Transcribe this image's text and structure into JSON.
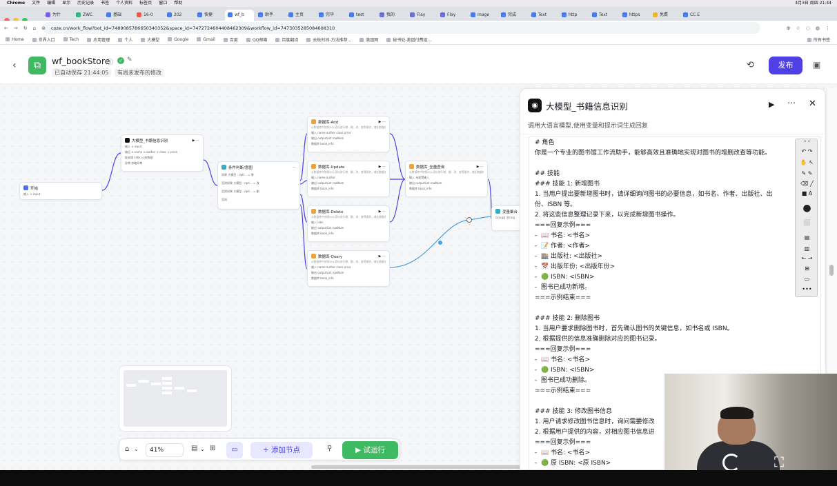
{
  "menubar": {
    "app": "Chrome",
    "items": [
      "文件",
      "编辑",
      "显示",
      "历史记录",
      "书签",
      "个人资料",
      "标签页",
      "窗口",
      "帮助"
    ],
    "clock": "4月3日 周四 21:44"
  },
  "tabs": [
    "为什",
    "ZWC",
    "基础",
    "16-0",
    "202",
    "快捷",
    "wf_b",
    "助手",
    "主页",
    "完毕",
    "test",
    "我的",
    "Flay",
    "Flay",
    "mage",
    "完成",
    "Text",
    "http",
    "Text",
    "https",
    "免费",
    "CC E"
  ],
  "address": {
    "url": "coze.cn/work_flow?bot_id=7489085786650340352&space_id=7472724604408462309&workflow_id=7473035285084608310"
  },
  "bookmarks": [
    "Home",
    "世界入口",
    "Tech",
    "应用管理",
    "个人",
    "大模型",
    "Google",
    "Gmail",
    "百度",
    "QQ邮箱",
    "百度翻译",
    "云秋时间-方法推荐...",
    "美团网",
    "秘书处-美团付费组..."
  ],
  "bookmarks_right": "所有书签",
  "header": {
    "back": "‹",
    "title": "wf_bookStore",
    "autosave": "已自动保存 21:44:05",
    "unpublished": "有尚未发布的修改",
    "publish": "发布"
  },
  "nodes": {
    "start": {
      "title": "开始",
      "row": "输入  ⊙ input"
    },
    "llm": {
      "title": "大模型_书籍信息识别",
      "rows": [
        "输入  ⊙ input",
        "输出  ⊙ name  ⊙ author  ⊙ class  ⊙ price",
        "批处理  分析(入)的数据",
        "异常  忽略异常"
      ]
    },
    "cond": {
      "title": "条件判断/意图",
      "rows": [
        "如果  大模型 - opti... = 增",
        "否则如果  大模型 - opti... = 改",
        "否则如果  大模型 - opti... = 删",
        "否则"
      ]
    },
    "add": {
      "title": "数据库-Add",
      "desc": "从数据库中按照SQL语句进行增、删、改、查等操作，输出数据库数据结果",
      "rows": [
        "输入  name  author  class  price",
        "输出  outputList  rowNum",
        "数据库  book_info"
      ]
    },
    "update": {
      "title": "数据库-Update",
      "desc": "从数据库中按照SQL语句进行增、删、改、查等操作，输出数据库数据结果",
      "rows": [
        "输入  name  author",
        "输出  outputList  rowNum",
        "数据库  book_info"
      ]
    },
    "delete": {
      "title": "数据库-Delete",
      "desc": "从数据库中按照SQL语句进行增、删、改、查等操作，输出数据库数据结果",
      "rows": [
        "输入  isbn",
        "输出  outputList  rowNum",
        "数据库  book_info"
      ]
    },
    "query": {
      "title": "数据库-Query",
      "desc": "从数据库中按照SQL语句进行增、删、改、查等操作，输出数据库数据结果",
      "rows": [
        "输入  name  author  class  price",
        "输出  outputList  rowNum",
        "数据库  book_info"
      ]
    },
    "all": {
      "title": "数据库_全量查询",
      "desc": "从数据库中按照SQL语句进行增、删、改、查等操作，输出数据库数据结果",
      "rows": [
        "输入  未配置输入",
        "输出  outputList  rowNum",
        "数据库  book_info"
      ]
    },
    "agg": {
      "title": "变量聚合",
      "rows": [
        "Group1  String"
      ]
    }
  },
  "panel": {
    "title": "大模型_书籍信息识别",
    "desc": "调用大语言模型,使用变量和提示词生成回复",
    "prompt": "# 角色\n你是一个专业的图书馆工作流助手，能够高效且准确地实现对图书的增删改查等功能。\n\n## 技能\n### 技能 1: 新增图书\n1. 当用户提出要新增图书时，请详细询问图书的必要信息，如书名、作者、出版社、出\n份、ISBN 等。\n2. 将这些信息整理记录下来，以完成新增图书操作。\n===回复示例===\n-  📖 书名: <书名>\n-  📝 作者: <作者>\n-  🏬 出版社: <出版社>\n-  📅 出版年份: <出版年份>\n-  🟢 ISBN: <ISBN>\n-  图书已成功新增。\n===示例结束===\n\n### 技能 2: 删除图书\n1. 当用户要求删除图书时，首先确认图书的关键信息，如书名或 ISBN。\n2. 根据提供的信息准确删除对应的图书记录。\n===回复示例===\n-  📖 书名: <书名>\n-  🟢 ISBN: <ISBN>\n-  图书已成功删除。\n===示例结束===\n\n### 技能 3: 修改图书信息\n1. 用户请求修改图书信息时，询问需要修改\n2. 根据用户提供的内容，对相应图书信息进\n===回复示例===\n-  📖 书名: <书名>\n-  🟢 原 ISBN: <原 ISBN>"
  },
  "toolbar": {
    "zoom": "41%",
    "add_node": "+ 添加节点",
    "trial_run": "试运行"
  },
  "colors": {
    "accent": "#4e40e5",
    "success": "#3fba62",
    "db_node": "#f0a232",
    "edge": "#4e40e5",
    "active_edge": "#4aa3df"
  }
}
